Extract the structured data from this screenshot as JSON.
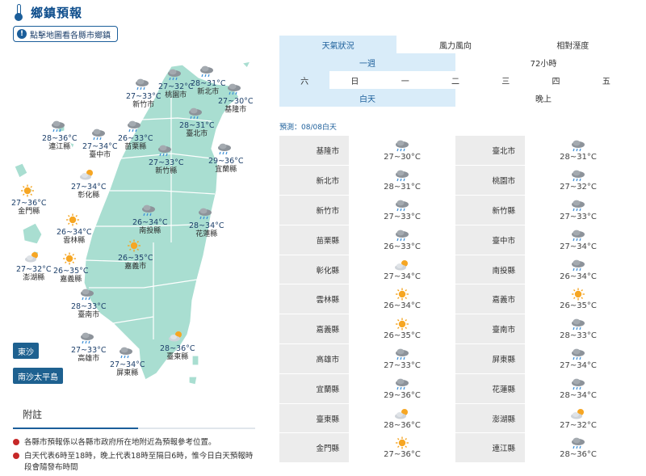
{
  "header": {
    "title": "鄉鎮預報",
    "icon": "thermometer-icon"
  },
  "hint": {
    "label": "點擊地圖看各縣市鄉鎮",
    "icon": "info-icon"
  },
  "islands": [
    {
      "label": "東沙"
    },
    {
      "label": "南沙太平島"
    }
  ],
  "map_locations": [
    {
      "name": "基隆市",
      "temp": "27~30°C",
      "icon": "cloud-rain-icon"
    },
    {
      "name": "新北市",
      "temp": "28~31°C",
      "icon": "cloud-rain-icon"
    },
    {
      "name": "桃園市",
      "temp": "27~32°C",
      "icon": "cloud-rain-icon"
    },
    {
      "name": "新竹市",
      "temp": "27~33°C",
      "icon": "cloud-rain-icon"
    },
    {
      "name": "臺北市",
      "temp": "28~31°C",
      "icon": "cloud-rain-icon"
    },
    {
      "name": "連江縣",
      "temp": "28~36°C",
      "icon": "cloud-rain-icon"
    },
    {
      "name": "臺中市",
      "temp": "27~34°C",
      "icon": "cloud-rain-icon"
    },
    {
      "name": "苗栗縣",
      "temp": "26~33°C",
      "icon": "cloud-rain-icon"
    },
    {
      "name": "新竹縣",
      "temp": "27~33°C",
      "icon": "cloud-rain-icon"
    },
    {
      "name": "宜蘭縣",
      "temp": "29~36°C",
      "icon": "cloud-rain-icon"
    },
    {
      "name": "彰化縣",
      "temp": "27~34°C",
      "icon": "sun-cloud-icon"
    },
    {
      "name": "金門縣",
      "temp": "27~36°C",
      "icon": "sun-icon"
    },
    {
      "name": "南投縣",
      "temp": "26~34°C",
      "icon": "cloud-rain-icon"
    },
    {
      "name": "花蓮縣",
      "temp": "28~34°C",
      "icon": "cloud-rain-icon"
    },
    {
      "name": "雲林縣",
      "temp": "26~34°C",
      "icon": "sun-icon"
    },
    {
      "name": "嘉義縣",
      "temp": "26~35°C",
      "icon": "sun-icon"
    },
    {
      "name": "嘉義市",
      "temp": "26~35°C",
      "icon": "sun-icon"
    },
    {
      "name": "澎湖縣",
      "temp": "27~32°C",
      "icon": "sun-cloud-icon"
    },
    {
      "name": "臺南市",
      "temp": "28~33°C",
      "icon": "cloud-rain-icon"
    },
    {
      "name": "高雄市",
      "temp": "27~33°C",
      "icon": "cloud-rain-icon"
    },
    {
      "name": "屏東縣",
      "temp": "27~34°C",
      "icon": "cloud-rain-icon"
    },
    {
      "name": "臺東縣",
      "temp": "28~36°C",
      "icon": "sun-cloud-icon"
    }
  ],
  "notes": {
    "title": "附註",
    "items": [
      "各縣市預報係以各縣市政府所在地附近為預報參考位置。",
      "白天代表6時至18時，晚上代表18時至隔日6時，惟今日白天預報時段會隨發布時間"
    ]
  },
  "tabs": {
    "type_tabs": [
      "天氣狀況",
      "風力風向",
      "相對溼度"
    ],
    "range_tabs": [
      "一週",
      "72小時"
    ],
    "days": [
      "六",
      "日",
      "一",
      "二",
      "三",
      "四",
      "五"
    ],
    "period_tabs": [
      "白天",
      "晚上"
    ]
  },
  "forecast_label": "預測：08/08白天",
  "table": [
    {
      "left": {
        "city": "基隆市",
        "temp": "27~30°C",
        "icon": "cloud-rain-icon"
      },
      "right": {
        "city": "臺北市",
        "temp": "28~31°C",
        "icon": "cloud-rain-icon"
      }
    },
    {
      "left": {
        "city": "新北市",
        "temp": "28~31°C",
        "icon": "cloud-rain-icon"
      },
      "right": {
        "city": "桃園市",
        "temp": "27~32°C",
        "icon": "cloud-rain-icon"
      }
    },
    {
      "left": {
        "city": "新竹市",
        "temp": "27~33°C",
        "icon": "cloud-rain-icon"
      },
      "right": {
        "city": "新竹縣",
        "temp": "27~33°C",
        "icon": "cloud-rain-icon"
      }
    },
    {
      "left": {
        "city": "苗栗縣",
        "temp": "26~33°C",
        "icon": "cloud-rain-icon"
      },
      "right": {
        "city": "臺中市",
        "temp": "27~34°C",
        "icon": "cloud-rain-icon"
      }
    },
    {
      "left": {
        "city": "彰化縣",
        "temp": "27~34°C",
        "icon": "sun-cloud-icon"
      },
      "right": {
        "city": "南投縣",
        "temp": "26~34°C",
        "icon": "cloud-rain-icon"
      }
    },
    {
      "left": {
        "city": "雲林縣",
        "temp": "26~34°C",
        "icon": "sun-icon"
      },
      "right": {
        "city": "嘉義市",
        "temp": "26~35°C",
        "icon": "sun-icon"
      }
    },
    {
      "left": {
        "city": "嘉義縣",
        "temp": "26~35°C",
        "icon": "sun-icon"
      },
      "right": {
        "city": "臺南市",
        "temp": "28~33°C",
        "icon": "cloud-rain-icon"
      }
    },
    {
      "left": {
        "city": "高雄市",
        "temp": "27~33°C",
        "icon": "cloud-rain-icon"
      },
      "right": {
        "city": "屏東縣",
        "temp": "27~34°C",
        "icon": "cloud-rain-icon"
      }
    },
    {
      "left": {
        "city": "宜蘭縣",
        "temp": "29~36°C",
        "icon": "cloud-rain-icon"
      },
      "right": {
        "city": "花蓮縣",
        "temp": "28~34°C",
        "icon": "cloud-rain-icon"
      }
    },
    {
      "left": {
        "city": "臺東縣",
        "temp": "28~36°C",
        "icon": "sun-cloud-icon"
      },
      "right": {
        "city": "澎湖縣",
        "temp": "27~32°C",
        "icon": "sun-cloud-icon"
      }
    },
    {
      "left": {
        "city": "金門縣",
        "temp": "27~36°C",
        "icon": "sun-icon"
      },
      "right": {
        "city": "連江縣",
        "temp": "28~36°C",
        "icon": "cloud-rain-icon"
      }
    }
  ],
  "colors": {
    "brand": "#1b5e9a",
    "map_fill": "#a9ded1",
    "tab_active": "#d9ecf9",
    "row_gray": "#ececec"
  }
}
